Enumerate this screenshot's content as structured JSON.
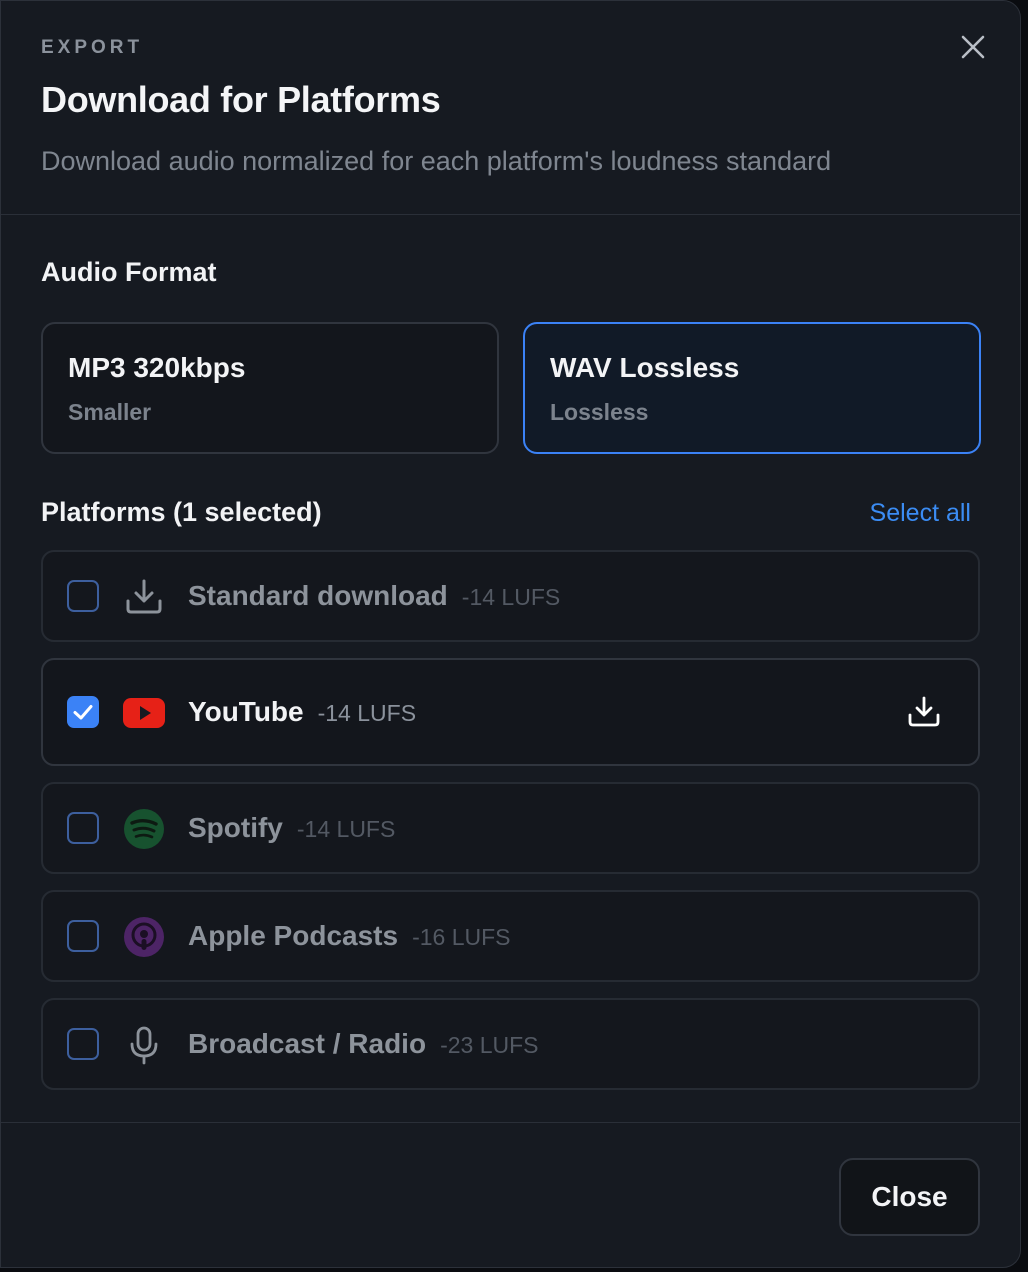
{
  "header": {
    "eyebrow": "EXPORT",
    "title": "Download for Platforms",
    "subtitle": "Download audio normalized for each platform's loudness standard",
    "close_icon": "close-icon"
  },
  "audio_format": {
    "label": "Audio Format",
    "options": [
      {
        "name": "MP3 320kbps",
        "desc": "Smaller",
        "selected": false
      },
      {
        "name": "WAV Lossless",
        "desc": "Lossless",
        "selected": true
      }
    ]
  },
  "platforms": {
    "label": "Platforms (1 selected)",
    "select_all": "Select all",
    "items": [
      {
        "name": "Standard download",
        "lufs": "-14 LUFS",
        "checked": false,
        "icon": "download-icon"
      },
      {
        "name": "YouTube",
        "lufs": "-14 LUFS",
        "checked": true,
        "icon": "youtube-icon"
      },
      {
        "name": "Spotify",
        "lufs": "-14 LUFS",
        "checked": false,
        "icon": "spotify-icon"
      },
      {
        "name": "Apple Podcasts",
        "lufs": "-16 LUFS",
        "checked": false,
        "icon": "apple-podcasts-icon"
      },
      {
        "name": "Broadcast / Radio",
        "lufs": "-23 LUFS",
        "checked": false,
        "icon": "microphone-icon"
      }
    ]
  },
  "footer": {
    "close_label": "Close"
  },
  "colors": {
    "accent": "#3b82f6",
    "background": "#161a21",
    "youtube": "#e62117",
    "spotify": "#1db954",
    "podcasts": "#8e3fc1"
  }
}
